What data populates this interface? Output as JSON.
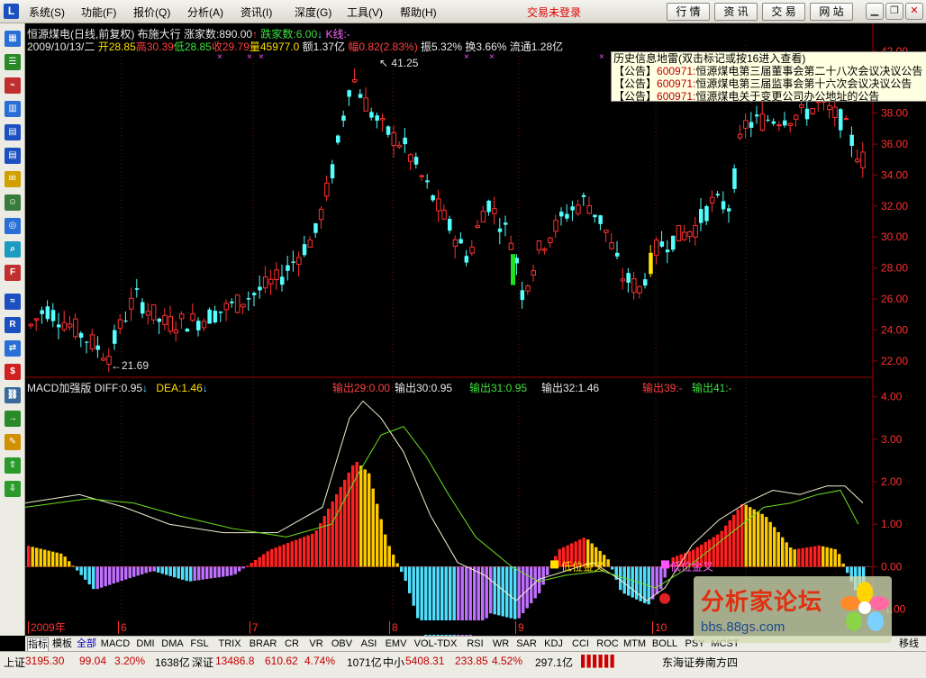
{
  "menu": {
    "app_logo": "L",
    "items": [
      "系统(S)",
      "功能(F)",
      "报价(Q)",
      "分析(A)",
      "资讯(I)",
      "深度(G)",
      "工具(V)",
      "帮助(H)"
    ],
    "login_status": "交易未登录",
    "buttons": [
      "行 情",
      "资 讯",
      "交 易",
      "网 站"
    ]
  },
  "toolbar_icons": [
    "grid-icon",
    "list-icon",
    "line-chart-icon",
    "bar-chart-icon",
    "table-icon",
    "table-icon",
    "news-icon",
    "people-icon",
    "fund-icon",
    "search-icon",
    "f10-icon",
    "wave-icon",
    "rsi-icon",
    "compare-icon",
    "dollar-icon",
    "link-icon",
    "export-icon",
    "pen-icon",
    "up-arrow-icon",
    "down-arrow-icon"
  ],
  "header": {
    "stock_name": "恒源煤电(日线,前复权)",
    "layout_name": "布施大行",
    "up_count_label": "涨家数:890.00",
    "down_count_label": "跌家数:6.00",
    "kline_label": "K线:-",
    "date": "2009/10/13/二",
    "open": "开28.85",
    "high": "高30.39",
    "low": "低28.85",
    "close": "收29.79",
    "volume": "量45977.0",
    "amount": "额1.37亿",
    "change": "幅0.82(2.83%)",
    "amplitude": "振5.32%",
    "turnover": "换3.66%",
    "float": "流通1.28亿"
  },
  "popup": {
    "title": "历史信息地雷(双击标记或按16进入查看)",
    "rows": [
      {
        "tag": "【公告】",
        "code": "600971:",
        "text": "恒源煤电第三届董事会第二十八次会议决议公告"
      },
      {
        "tag": "【公告】",
        "code": "600971:",
        "text": "恒源煤电第三届监事会第十六次会议决议公告"
      },
      {
        "tag": "【公告】",
        "code": "600971:",
        "text": "恒源煤电关于变更公司办公地址的公告"
      }
    ]
  },
  "price_axis": [
    "42.00",
    "40.00",
    "38.00",
    "36.00",
    "34.00",
    "32.00",
    "30.00",
    "28.00",
    "26.00",
    "24.00",
    "22.00"
  ],
  "price_annotations": {
    "high": "41.25",
    "low": "21.69"
  },
  "macd": {
    "name": "MACD加强版",
    "diff": "DIFF:0.95",
    "dea": "DEA:1.46",
    "out29": "输出29:0.00",
    "out30": "输出30:0.95",
    "out31": "输出31:0.95",
    "out32": "输出32:1.46",
    "out39": "输出39:-",
    "out41": "输出41:-",
    "axis": [
      "4.00",
      "3.00",
      "2.00",
      "1.00",
      "0.00",
      "-1.00"
    ],
    "signal1": "低位金叉",
    "signal2": "低位金叉"
  },
  "time_axis": [
    "2009年",
    "6",
    "7",
    "8",
    "9",
    "10",
    "11"
  ],
  "tabs": [
    "指标",
    "模板",
    "全部",
    "MACD",
    "DMI",
    "DMA",
    "FSL",
    "TRIX",
    "BRAR",
    "CR",
    "VR",
    "OBV",
    "ASI",
    "EMV",
    "VOL-TDX",
    "RSI",
    "WR",
    "SAR",
    "KDJ",
    "CCI",
    "ROC",
    "MTM",
    "BOLL",
    "PSY",
    "MCST"
  ],
  "tab_right_label": "移线",
  "status": {
    "sh_label": "上证",
    "sh_value": "3195.30",
    "sh_change": "99.04",
    "sh_pct": "3.20%",
    "sh_amount": "1638亿",
    "sz_label": "深证",
    "sz_value": "13486.8",
    "sz_change": "610.62",
    "sz_pct": "4.74%",
    "sz_amount": "1071亿",
    "sme_label": "中小",
    "sme_value": "5408.31",
    "sme_change": "233.85",
    "sme_pct": "4.52%",
    "sme_amount": "297.1亿",
    "broker": "东海证券南方四"
  },
  "watermark": {
    "title": "分析家论坛",
    "url": "bbs.88gs.com"
  },
  "colors": {
    "up": "#ff3030",
    "down": "#54ffff",
    "flat": "#ffe600",
    "macd_pos": "#ff2020",
    "macd_pos2": "#ffcc00",
    "macd_neg": "#50e0ff",
    "macd_neg2": "#c070ff"
  }
}
